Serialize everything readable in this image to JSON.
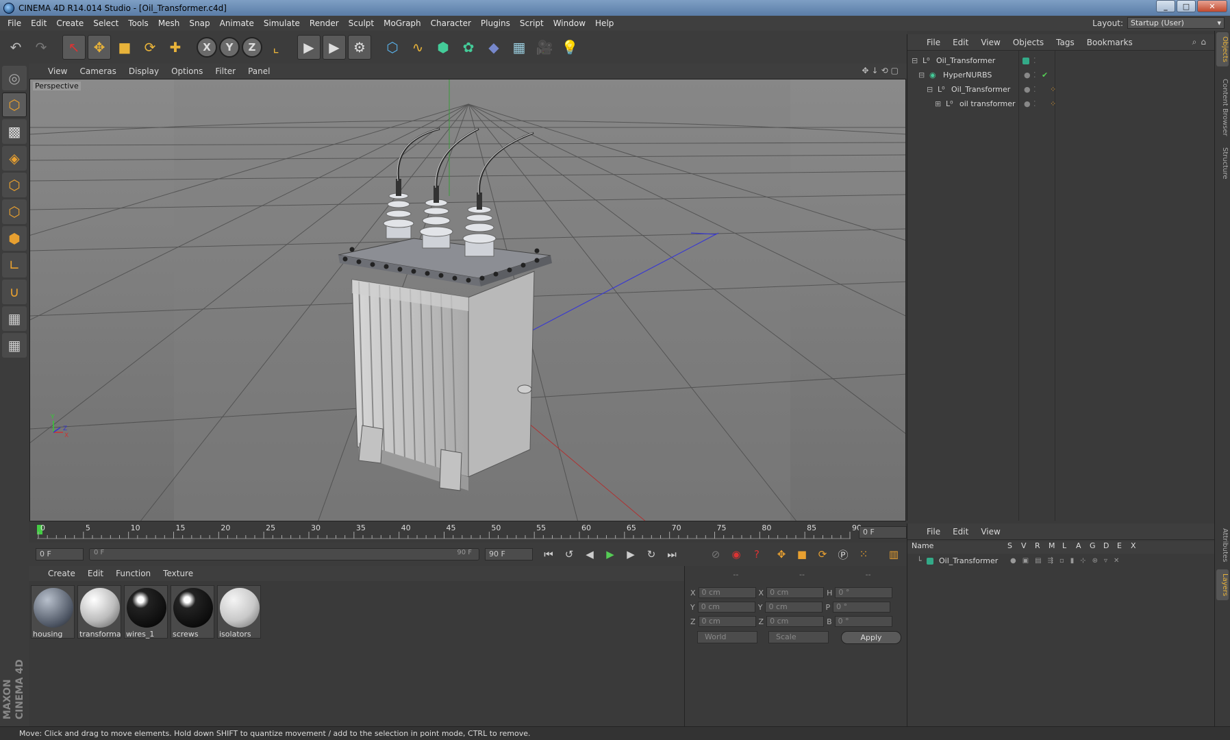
{
  "window": {
    "title": "CINEMA 4D R14.014 Studio - [Oil_Transformer.c4d]"
  },
  "menubar": {
    "items": [
      "File",
      "Edit",
      "Create",
      "Select",
      "Tools",
      "Mesh",
      "Snap",
      "Animate",
      "Simulate",
      "Render",
      "Sculpt",
      "MoGraph",
      "Character",
      "Plugins",
      "Script",
      "Window",
      "Help"
    ],
    "layout_label": "Layout:",
    "layout_value": "Startup (User)"
  },
  "toolbar": {
    "axis_x": "X",
    "axis_y": "Y",
    "axis_z": "Z"
  },
  "viewport": {
    "menu": [
      "View",
      "Cameras",
      "Display",
      "Options",
      "Filter",
      "Panel"
    ],
    "label": "Perspective"
  },
  "timeline": {
    "ticks": [
      "0",
      "5",
      "10",
      "15",
      "20",
      "25",
      "30",
      "35",
      "40",
      "45",
      "50",
      "55",
      "60",
      "65",
      "70",
      "75",
      "80",
      "85",
      "90"
    ],
    "current_frame": "0 F",
    "start_field": "0 F",
    "range_start": "0 F",
    "range_end": "90 F",
    "end_field": "90 F"
  },
  "materials": {
    "menu": [
      "Create",
      "Edit",
      "Function",
      "Texture"
    ],
    "items": [
      {
        "name": "housing"
      },
      {
        "name": "transforma"
      },
      {
        "name": "wires_1"
      },
      {
        "name": "screws"
      },
      {
        "name": "isolators"
      }
    ]
  },
  "coordinates": {
    "header": [
      "--",
      "--",
      "--"
    ],
    "rows": [
      {
        "axis": "X",
        "pos": "0 cm",
        "axis2": "X",
        "size": "0 cm",
        "rot_label": "H",
        "rot": "0 °"
      },
      {
        "axis": "Y",
        "pos": "0 cm",
        "axis2": "Y",
        "size": "0 cm",
        "rot_label": "P",
        "rot": "0 °"
      },
      {
        "axis": "Z",
        "pos": "0 cm",
        "axis2": "Z",
        "size": "0 cm",
        "rot_label": "B",
        "rot": "0 °"
      }
    ],
    "space": "World",
    "mode": "Scale",
    "apply": "Apply"
  },
  "objects": {
    "menu": [
      "File",
      "Edit",
      "View",
      "Objects",
      "Tags",
      "Bookmarks"
    ],
    "tree": [
      {
        "label": "Oil_Transformer"
      },
      {
        "label": "HyperNURBS"
      },
      {
        "label": "Oil_Transformer"
      },
      {
        "label": "oil transformer"
      }
    ]
  },
  "layers": {
    "menu": [
      "File",
      "Edit",
      "View"
    ],
    "columns": [
      "Name",
      "S",
      "V",
      "R",
      "M",
      "L",
      "A",
      "G",
      "D",
      "E",
      "X"
    ],
    "rows": [
      {
        "name": "Oil_Transformer"
      }
    ]
  },
  "sidetabs": [
    "Objects",
    "Content Browser",
    "Structure",
    "Attributes",
    "Layers"
  ],
  "brand": "MAXON CINEMA 4D",
  "status": "Move: Click and drag to move elements. Hold down SHIFT to quantize movement / add to the selection in point mode, CTRL to remove."
}
